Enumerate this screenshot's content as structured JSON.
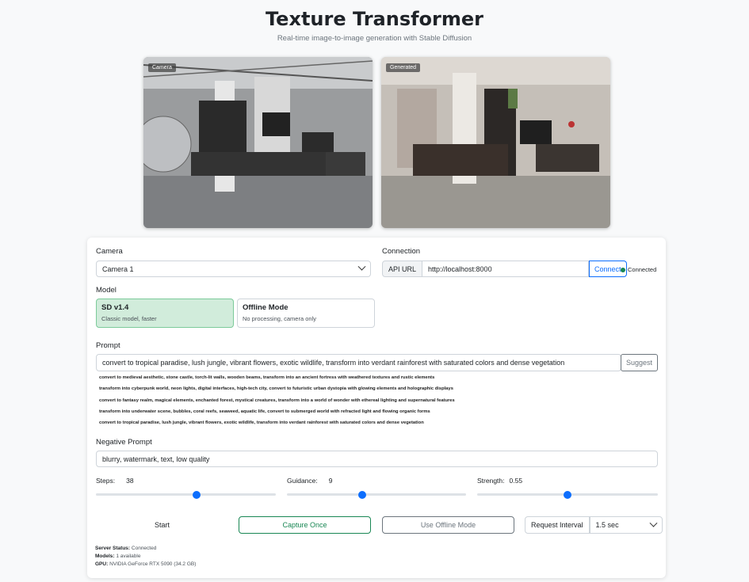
{
  "header": {
    "title": "Texture Transformer",
    "subtitle": "Real-time image-to-image generation with Stable Diffusion"
  },
  "videos": {
    "camera_badge": "Camera",
    "generated_badge": "Generated"
  },
  "camera": {
    "label": "Camera",
    "selected": "Camera 1"
  },
  "connection": {
    "label": "Connection",
    "api_label": "API URL",
    "api_url": "http://localhost:8000",
    "connect_button": "Connect",
    "status": "Connected",
    "status_color": "#198754"
  },
  "model": {
    "label": "Model",
    "options": [
      {
        "name": "SD v1.4",
        "desc": "Classic model, faster",
        "active": true
      },
      {
        "name": "Offline Mode",
        "desc": "No processing, camera only",
        "active": false
      }
    ]
  },
  "prompt": {
    "label": "Prompt",
    "value": "convert to tropical paradise, lush jungle, vibrant flowers, exotic wildlife, transform into verdant rainforest with saturated colors and dense vegetation",
    "suggest_button": "Suggest",
    "suggestions": [
      "convert to medieval aesthetic, stone castle, torch-lit walls, wooden beams, transform into an ancient fortress with weathered textures and rustic elements",
      "transform into cyberpunk world, neon lights, digital interfaces, high-tech city, convert to futuristic urban dystopia with glowing elements and holographic displays",
      "convert to fantasy realm, magical elements, enchanted forest, mystical creatures, transform into a world of wonder with ethereal lighting and supernatural features",
      "transform into underwater scene, bubbles, coral reefs, seaweed, aquatic life, convert to submerged world with refracted light and flowing organic forms",
      "convert to tropical paradise, lush jungle, vibrant flowers, exotic wildlife, transform into verdant rainforest with saturated colors and dense vegetation"
    ]
  },
  "negative_prompt": {
    "label": "Negative Prompt",
    "value": "blurry, watermark, text, low quality"
  },
  "sliders": {
    "steps": {
      "label": "Steps:",
      "value": "38",
      "fraction": 0.56
    },
    "guidance": {
      "label": "Guidance:",
      "value": "9",
      "fraction": 0.42
    },
    "strength": {
      "label": "Strength:",
      "value": "0.55",
      "fraction": 0.5
    }
  },
  "actions": {
    "start": "Start",
    "capture_once": "Capture Once",
    "use_offline": "Use Offline Mode",
    "interval_label": "Request Interval",
    "interval_value": "1.5 sec"
  },
  "server": {
    "status_label": "Server Status:",
    "status_value": "Connected",
    "models_label": "Models:",
    "models_value": "1 available",
    "gpu_label": "GPU:",
    "gpu_value": "NVIDIA GeForce RTX 5090 (34.2 GB)"
  }
}
